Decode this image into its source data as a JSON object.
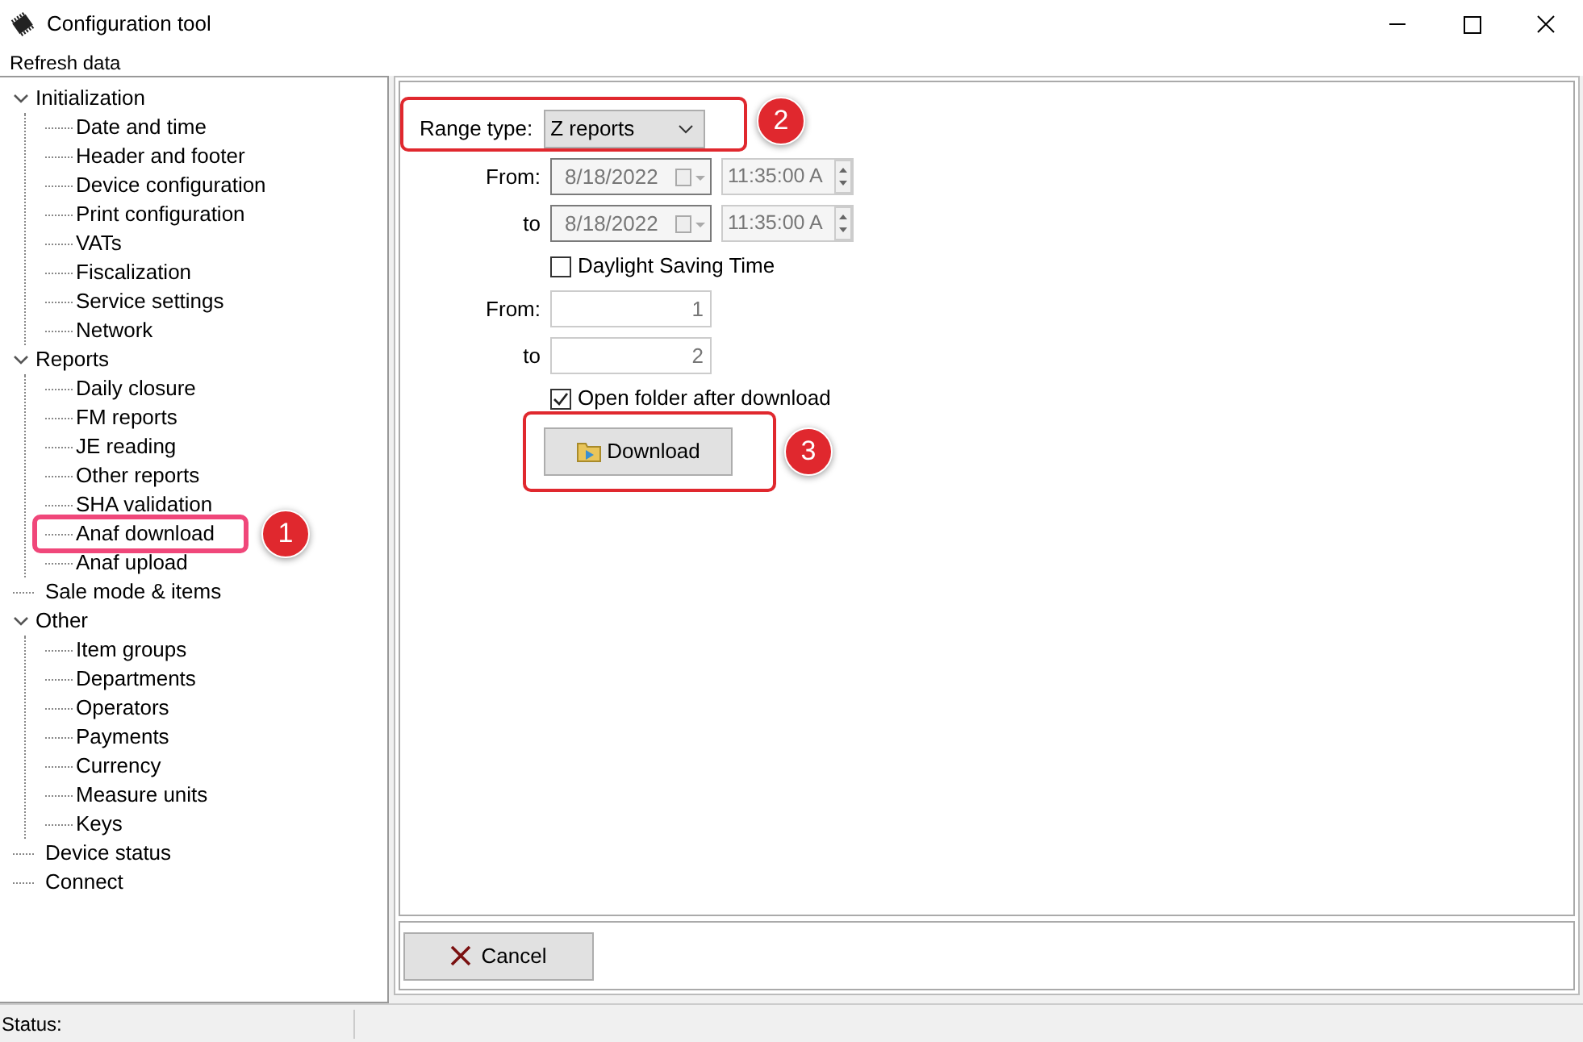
{
  "window": {
    "title": "Configuration tool"
  },
  "menu": [
    "Refresh data"
  ],
  "tree": [
    {
      "label": "Initialization",
      "expanded": true,
      "children": [
        {
          "label": "Date and time"
        },
        {
          "label": "Header and footer"
        },
        {
          "label": "Device configuration"
        },
        {
          "label": "Print configuration"
        },
        {
          "label": "VATs"
        },
        {
          "label": "Fiscalization"
        },
        {
          "label": "Service settings"
        },
        {
          "label": "Network"
        }
      ]
    },
    {
      "label": "Reports",
      "expanded": true,
      "children": [
        {
          "label": "Daily closure"
        },
        {
          "label": "FM reports"
        },
        {
          "label": "JE reading"
        },
        {
          "label": "Other reports"
        },
        {
          "label": "SHA validation"
        },
        {
          "label": "Anaf download",
          "callout": "1"
        },
        {
          "label": "Anaf upload"
        }
      ]
    },
    {
      "label": "Sale mode & items"
    },
    {
      "label": "Other",
      "expanded": true,
      "children": [
        {
          "label": "Item groups"
        },
        {
          "label": "Departments"
        },
        {
          "label": "Operators"
        },
        {
          "label": "Payments"
        },
        {
          "label": "Currency"
        },
        {
          "label": "Measure units"
        },
        {
          "label": "Keys"
        }
      ]
    },
    {
      "label": "Device status"
    },
    {
      "label": "Connect"
    }
  ],
  "form": {
    "range_type": {
      "label": "Range type:",
      "value": "Z reports",
      "callout": "2"
    },
    "date_from": {
      "label": "From:",
      "date": "8/18/2022",
      "time": "11:35:00 A"
    },
    "date_to": {
      "label": "to",
      "date": "8/18/2022",
      "time": "11:35:00 A"
    },
    "daylight_saving": {
      "label": "Daylight Saving Time",
      "checked": false
    },
    "number_from": {
      "label": "From:",
      "value": "1"
    },
    "number_to": {
      "label": "to",
      "value": "2"
    },
    "open_folder": {
      "label": "Open folder after download",
      "checked": true
    },
    "download": {
      "label": "Download",
      "callout": "3"
    }
  },
  "cancel": {
    "label": "Cancel"
  },
  "status_bar": {
    "label": "Status:"
  }
}
